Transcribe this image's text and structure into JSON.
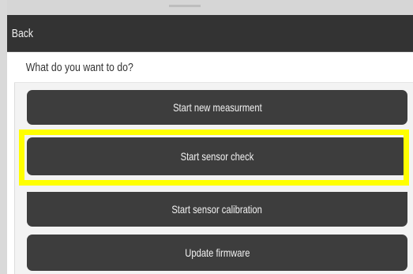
{
  "header": {
    "back_label": "Back"
  },
  "prompt": {
    "text": "What do you want to do?"
  },
  "actions": [
    {
      "label": "Start new measurment"
    },
    {
      "label": "Start sensor check",
      "highlighted": true
    },
    {
      "label": "Start sensor calibration"
    },
    {
      "label": "Update firmware"
    }
  ],
  "colors": {
    "titlebar": "#333333",
    "button": "#3d3d3d",
    "button_text": "#f2f2f2",
    "highlight": "#ffff00",
    "panel": "#f3f3f3"
  }
}
